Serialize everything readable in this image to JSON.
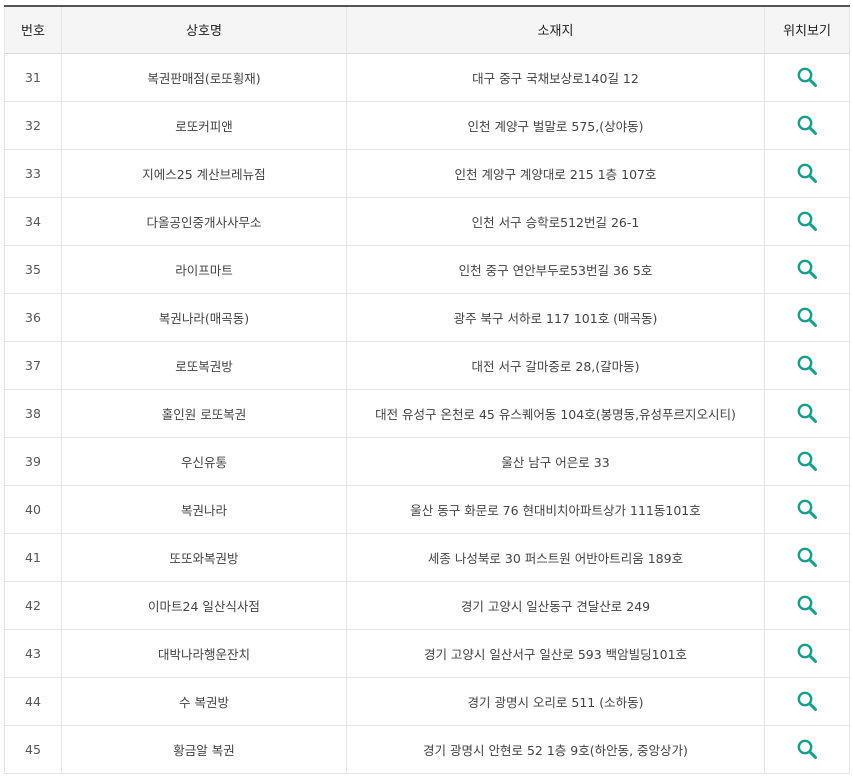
{
  "table": {
    "headers": {
      "number": "번호",
      "name": "상호명",
      "address": "소재지",
      "location": "위치보기"
    },
    "icon": "search-icon",
    "icon_color": "#1a9e8f",
    "rows": [
      {
        "number": "31",
        "name": "복권판매점(로또횡재)",
        "address": "대구 중구 국채보상로140길 12"
      },
      {
        "number": "32",
        "name": "로또커피앤",
        "address": "인천 계양구 벌말로 575,(상야동)"
      },
      {
        "number": "33",
        "name": "지에스25 계산브레뉴점",
        "address": "인천 계양구 계양대로 215 1층 107호"
      },
      {
        "number": "34",
        "name": "다올공인중개사사무소",
        "address": "인천 서구 승학로512번길 26-1"
      },
      {
        "number": "35",
        "name": "라이프마트",
        "address": "인천 중구 연안부두로53번길 36 5호"
      },
      {
        "number": "36",
        "name": "복권나라(매곡동)",
        "address": "광주 북구 서하로 117 101호 (매곡동)"
      },
      {
        "number": "37",
        "name": "로또복권방",
        "address": "대전 서구 갈마중로 28,(갈마동)"
      },
      {
        "number": "38",
        "name": "홀인원 로또복권",
        "address": "대전 유성구 온천로 45 유스퀘어동 104호(봉명동,유성푸르지오시티)"
      },
      {
        "number": "39",
        "name": "우신유통",
        "address": "울산 남구 어은로 33"
      },
      {
        "number": "40",
        "name": "복권나라",
        "address": "울산 동구 화문로 76 현대비치아파트상가 111동101호"
      },
      {
        "number": "41",
        "name": "또또와복권방",
        "address": "세종 나성북로 30 퍼스트원 어반아트리움 189호"
      },
      {
        "number": "42",
        "name": "이마트24 일산식사점",
        "address": "경기 고양시 일산동구 견달산로 249"
      },
      {
        "number": "43",
        "name": "대박나라행운잔치",
        "address": "경기 고양시 일산서구 일산로 593 백암빌딩101호"
      },
      {
        "number": "44",
        "name": "수 복권방",
        "address": "경기 광명시 오리로 511 (소하동)"
      },
      {
        "number": "45",
        "name": "황금알 복권",
        "address": "경기 광명시 안현로 52 1층 9호(하안동, 중앙상가)"
      }
    ]
  }
}
